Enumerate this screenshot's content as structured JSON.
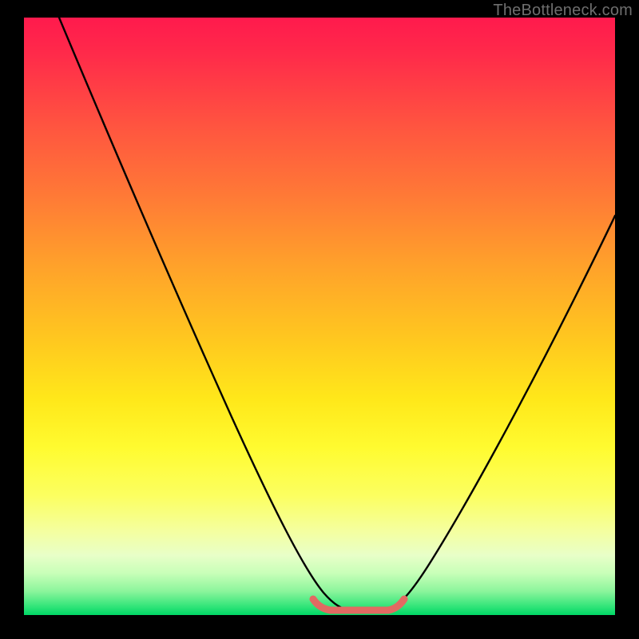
{
  "watermark": {
    "text": "TheBottleneck.com"
  },
  "colors": {
    "curve": "#000000",
    "valley_stroke": "#e26a62",
    "frame": "#000000"
  },
  "chart_data": {
    "type": "line",
    "title": "",
    "xlabel": "",
    "ylabel": "",
    "xlim": [
      0,
      100
    ],
    "ylim": [
      0,
      100
    ],
    "grid": false,
    "legend": false,
    "note": "Axis values are estimated from pixel positions; the figure has no tick labels.",
    "series": [
      {
        "name": "bottleneck-curve",
        "x": [
          6,
          10,
          15,
          20,
          25,
          30,
          35,
          40,
          45,
          48,
          50,
          52,
          54,
          56,
          58,
          60,
          62,
          65,
          70,
          75,
          80,
          85,
          90,
          95,
          100
        ],
        "y": [
          100,
          91,
          80,
          69,
          58,
          47,
          37,
          27,
          17,
          10,
          6,
          3,
          1,
          0.5,
          0.5,
          1,
          3,
          7,
          14,
          22,
          30,
          38,
          45,
          52,
          58
        ],
        "color": "#000000"
      }
    ],
    "annotations": [
      {
        "name": "valley-band",
        "type": "segment",
        "x_range": [
          49,
          62
        ],
        "y": 0.8,
        "color": "#e26a62",
        "stroke_width_px": 9
      }
    ]
  }
}
